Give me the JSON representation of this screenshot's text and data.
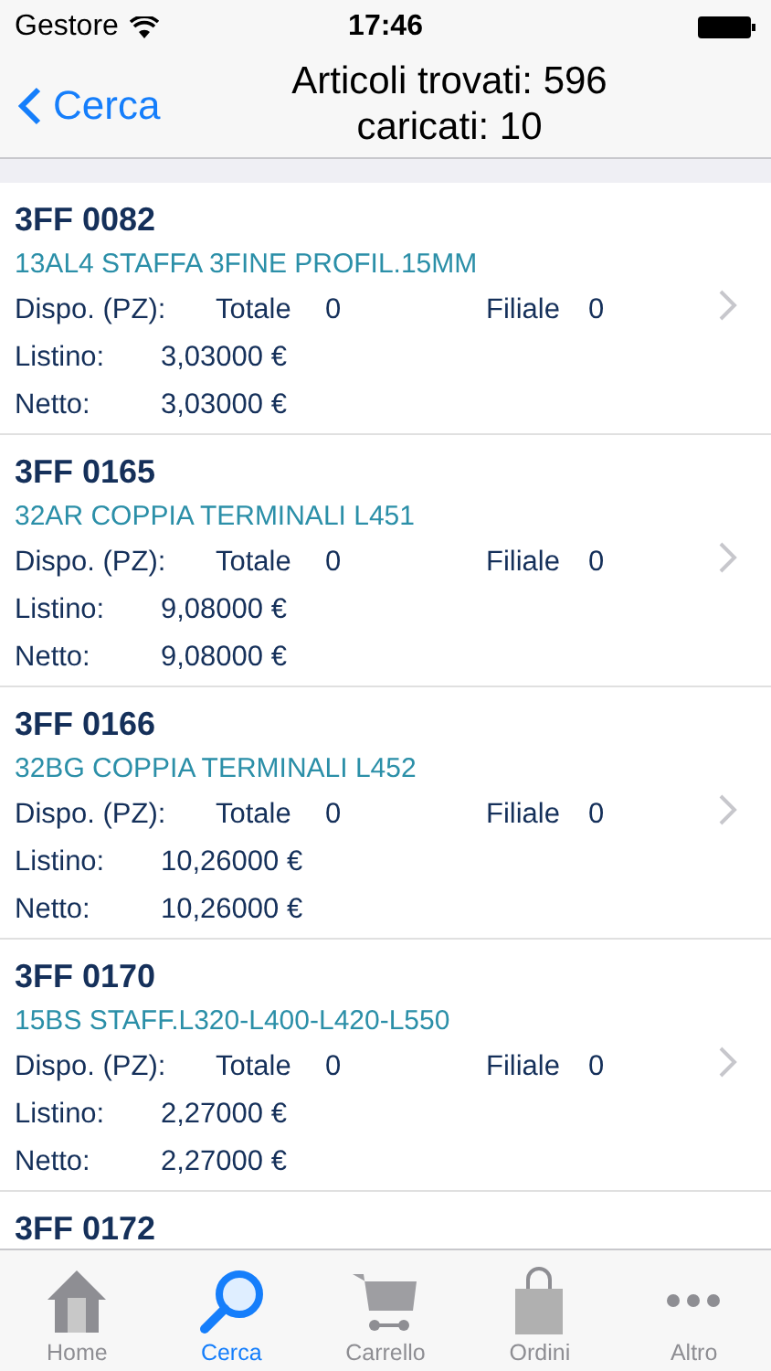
{
  "status_bar": {
    "carrier": "Gestore",
    "time": "17:46"
  },
  "nav": {
    "back": "Cerca",
    "title_line_1": "Articoli trovati: 596",
    "title_line_2": "caricati: 10"
  },
  "items": [
    {
      "code": "3FF 0082",
      "description": "13AL4 STAFFA 3FINE PROFIL.15MM",
      "dispo_label": "Dispo. (PZ):",
      "totale_label": "Totale",
      "totale": "0",
      "filiale_label": "Filiale",
      "filiale": "0",
      "listino_label": "Listino:",
      "listino": "3,03000 €",
      "netto_label": "Netto:",
      "netto": "3,03000 €"
    },
    {
      "code": "3FF 0165",
      "description": "32AR COPPIA TERMINALI L451",
      "dispo_label": "Dispo. (PZ):",
      "totale_label": "Totale",
      "totale": "0",
      "filiale_label": "Filiale",
      "filiale": "0",
      "listino_label": "Listino:",
      "listino": "9,08000 €",
      "netto_label": "Netto:",
      "netto": "9,08000 €"
    },
    {
      "code": "3FF 0166",
      "description": "32BG COPPIA TERMINALI L452",
      "dispo_label": "Dispo. (PZ):",
      "totale_label": "Totale",
      "totale": "0",
      "filiale_label": "Filiale",
      "filiale": "0",
      "listino_label": "Listino:",
      "listino": "10,26000 €",
      "netto_label": "Netto:",
      "netto": "10,26000 €"
    },
    {
      "code": "3FF 0170",
      "description": "15BS STAFF.L320-L400-L420-L550",
      "dispo_label": "Dispo. (PZ):",
      "totale_label": "Totale",
      "totale": "0",
      "filiale_label": "Filiale",
      "filiale": "0",
      "listino_label": "Listino:",
      "listino": "2,27000 €",
      "netto_label": "Netto:",
      "netto": "2,27000 €"
    },
    {
      "code": "3FF 0172"
    }
  ],
  "tabs": [
    {
      "kind": "home",
      "label": "Home",
      "selected": false
    },
    {
      "kind": "search",
      "label": "Cerca",
      "selected": true
    },
    {
      "kind": "cart",
      "label": "Carrello",
      "selected": false
    },
    {
      "kind": "bag",
      "label": "Ordini",
      "selected": false
    },
    {
      "kind": "more",
      "label": "Altro",
      "selected": false
    }
  ]
}
